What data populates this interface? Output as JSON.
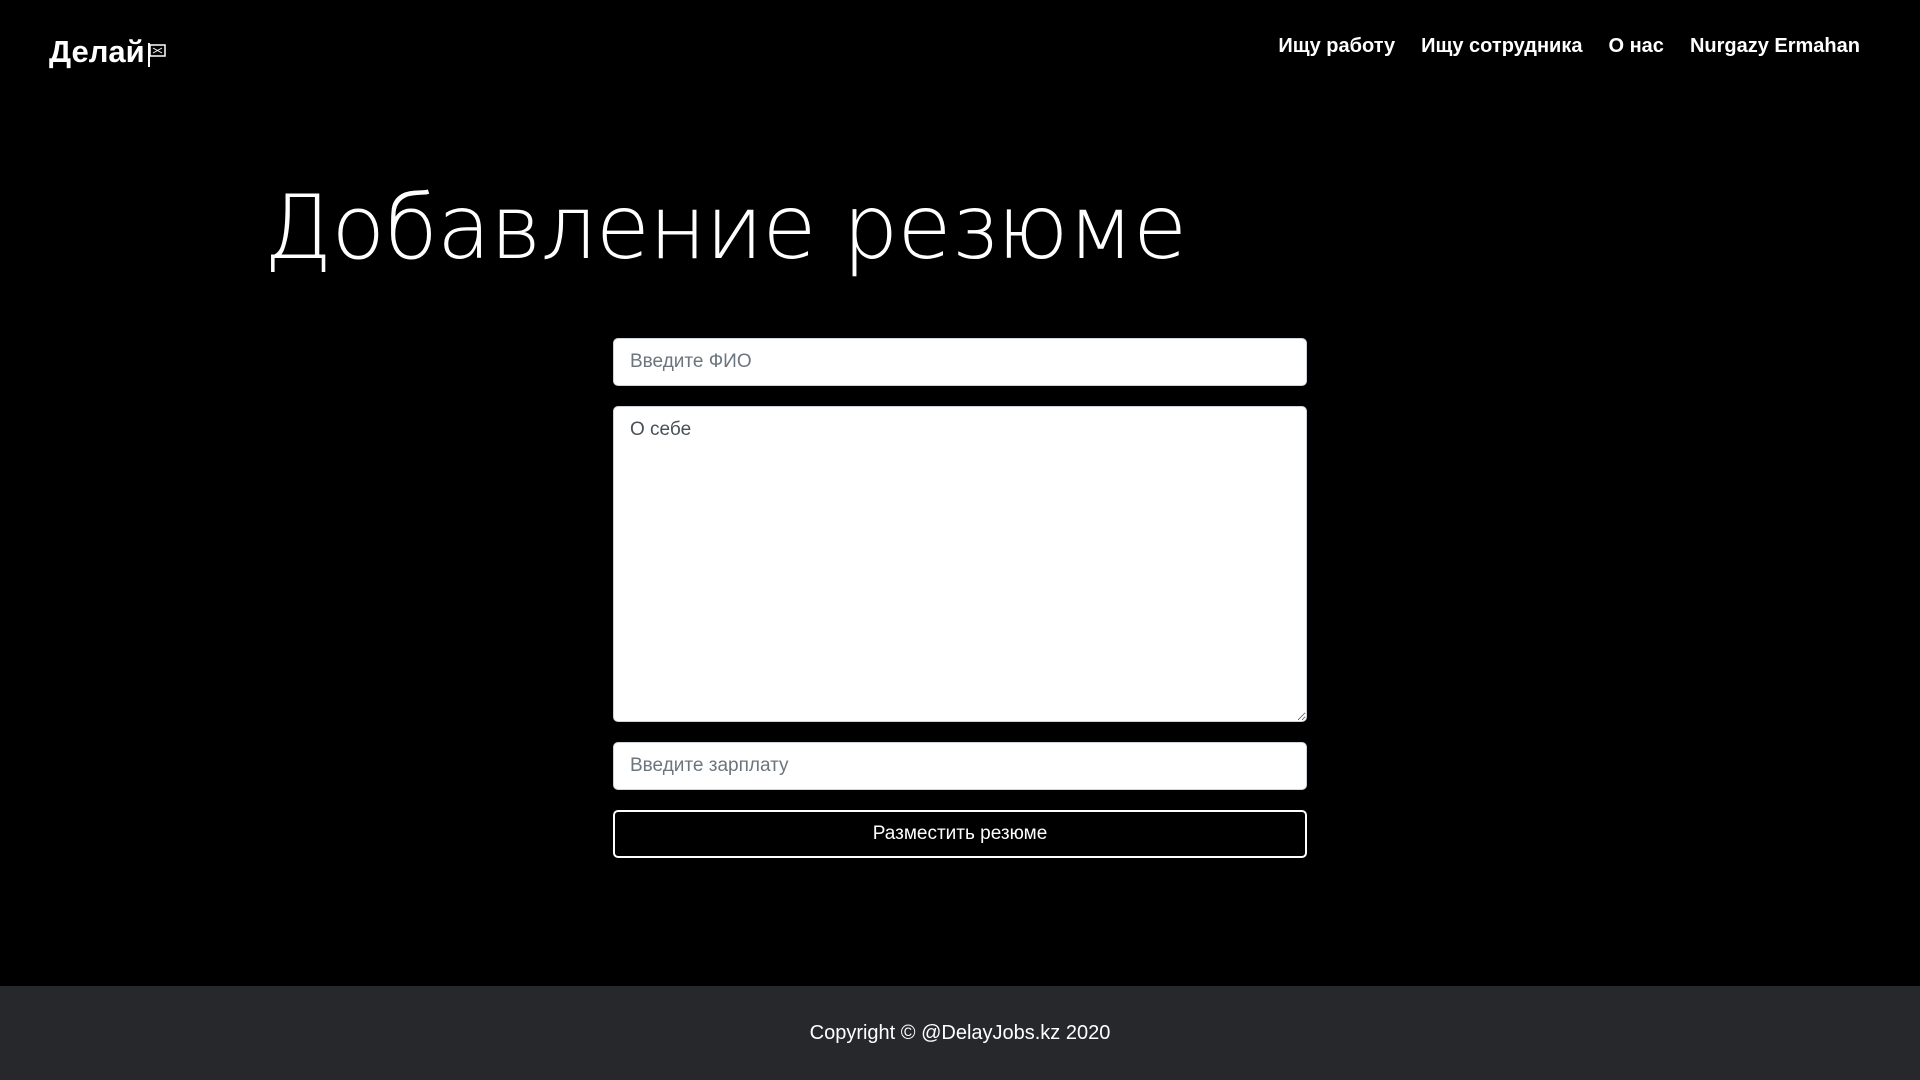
{
  "header": {
    "brand": "Делай",
    "brand_icon": "flag-icon",
    "nav": [
      {
        "label": "Ищу работу"
      },
      {
        "label": "Ищу сотрудника"
      },
      {
        "label": "О нас"
      },
      {
        "label": "Nurgazy Ermahan"
      }
    ]
  },
  "main": {
    "title": "Добавление резюме",
    "form": {
      "name_placeholder": "Введите ФИО",
      "about_placeholder": "О себе",
      "salary_placeholder": "Введите зарплату",
      "submit_label": "Разместить резюме"
    }
  },
  "footer": {
    "text": "Copyright © @DelayJobs.kz 2020"
  },
  "colors": {
    "background": "#000000",
    "footer_background": "#26282c",
    "text": "#ffffff"
  }
}
